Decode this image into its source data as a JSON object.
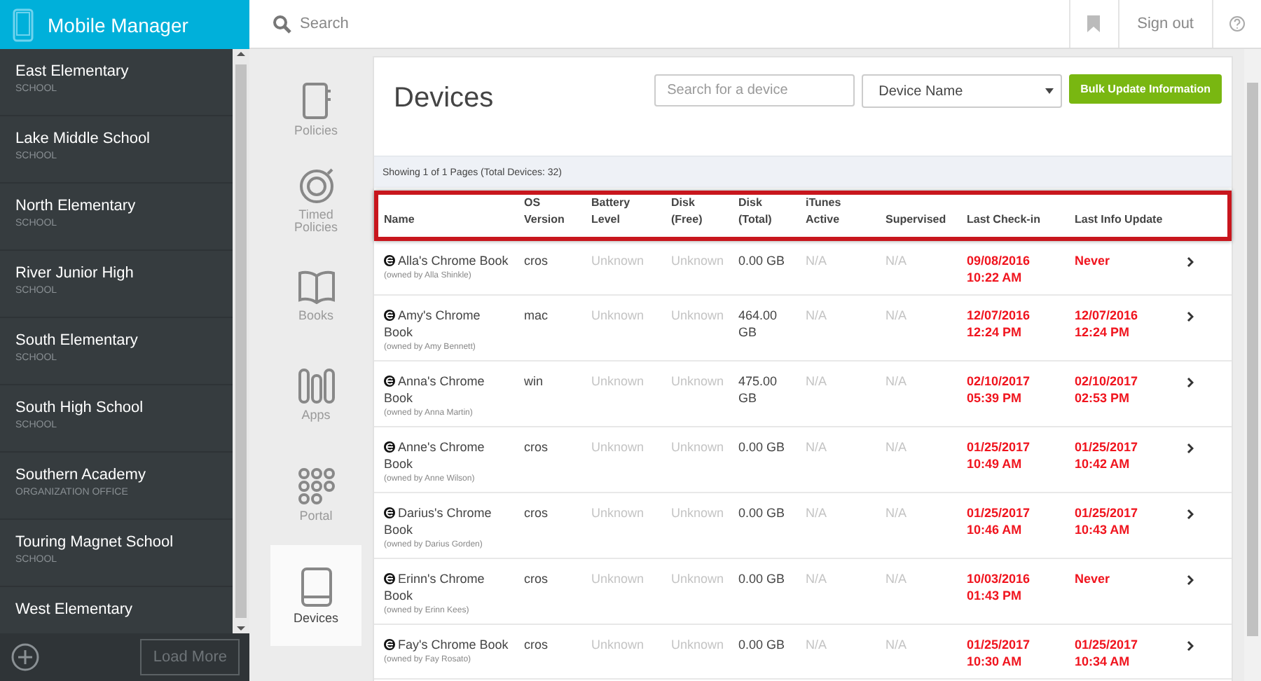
{
  "app": {
    "title": "Mobile Manager"
  },
  "topbar": {
    "search_placeholder": "Search",
    "sign_out": "Sign out"
  },
  "sidebar": {
    "items": [
      {
        "name": "East Elementary",
        "type": "SCHOOL"
      },
      {
        "name": "Lake Middle School",
        "type": "SCHOOL"
      },
      {
        "name": "North Elementary",
        "type": "SCHOOL"
      },
      {
        "name": "River Junior High",
        "type": "SCHOOL"
      },
      {
        "name": "South Elementary",
        "type": "SCHOOL"
      },
      {
        "name": "South High School",
        "type": "SCHOOL"
      },
      {
        "name": "Southern Academy",
        "type": "ORGANIZATION OFFICE"
      },
      {
        "name": "Touring Magnet School",
        "type": "SCHOOL"
      },
      {
        "name": "West Elementary"
      }
    ],
    "load_more": "Load More"
  },
  "nav": [
    {
      "kind": "notebook",
      "label": "Policies",
      "selected": false
    },
    {
      "kind": "timer",
      "label": "Timed Policies",
      "selected": false
    },
    {
      "kind": "book",
      "label": "Books",
      "selected": false
    },
    {
      "kind": "apps",
      "label": "Apps",
      "selected": false
    },
    {
      "kind": "grid",
      "label": "Portal",
      "selected": false
    },
    {
      "kind": "tablet",
      "label": "Devices",
      "selected": true
    }
  ],
  "page": {
    "title": "Devices",
    "search_placeholder": "Search for a device",
    "sort_select": "Device Name",
    "bulk_button": "Bulk Update Information"
  },
  "table": {
    "summary": "Showing 1 of 1 Pages (Total Devices: 32)",
    "header_highlighted": true,
    "columns": [
      "Name",
      "OS Version",
      "Battery Level",
      "Disk (Free)",
      "Disk (Total)",
      "iTunes Active",
      "Supervised",
      "Last Check-in",
      "Last Info Update"
    ],
    "rows": [
      {
        "name": "Alla's Chrome Book",
        "owner": "(owned by Alla Shinkle)",
        "os": "cros",
        "battery": "Unknown",
        "disk_free": "Unknown",
        "disk_total": "0.00 GB",
        "itunes": "N/A",
        "supervised": "N/A",
        "last_checkin": "09/08/2016 10:22 AM",
        "last_info": "Never"
      },
      {
        "name": "Amy's Chrome Book",
        "owner": "(owned by Amy Bennett)",
        "os": "mac",
        "battery": "Unknown",
        "disk_free": "Unknown",
        "disk_total": "464.00 GB",
        "itunes": "N/A",
        "supervised": "N/A",
        "last_checkin": "12/07/2016 12:24 PM",
        "last_info": "12/07/2016 12:24 PM"
      },
      {
        "name": "Anna's Chrome Book",
        "owner": "(owned by Anna Martin)",
        "os": "win",
        "battery": "Unknown",
        "disk_free": "Unknown",
        "disk_total": "475.00 GB",
        "itunes": "N/A",
        "supervised": "N/A",
        "last_checkin": "02/10/2017 05:39 PM",
        "last_info": "02/10/2017 02:53 PM"
      },
      {
        "name": "Anne's Chrome Book",
        "owner": "(owned by Anne Wilson)",
        "os": "cros",
        "battery": "Unknown",
        "disk_free": "Unknown",
        "disk_total": "0.00 GB",
        "itunes": "N/A",
        "supervised": "N/A",
        "last_checkin": "01/25/2017 10:49 AM",
        "last_info": "01/25/2017 10:42 AM"
      },
      {
        "name": "Darius's Chrome Book",
        "owner": "(owned by Darius Gorden)",
        "os": "cros",
        "battery": "Unknown",
        "disk_free": "Unknown",
        "disk_total": "0.00 GB",
        "itunes": "N/A",
        "supervised": "N/A",
        "last_checkin": "01/25/2017 10:46 AM",
        "last_info": "01/25/2017 10:43 AM"
      },
      {
        "name": "Erinn's Chrome Book",
        "owner": "(owned by Erinn Kees)",
        "os": "cros",
        "battery": "Unknown",
        "disk_free": "Unknown",
        "disk_total": "0.00 GB",
        "itunes": "N/A",
        "supervised": "N/A",
        "last_checkin": "10/03/2016 01:43 PM",
        "last_info": "Never"
      },
      {
        "name": "Fay's Chrome Book",
        "owner": "(owned by Fay Rosato)",
        "os": "cros",
        "battery": "Unknown",
        "disk_free": "Unknown",
        "disk_total": "0.00 GB",
        "itunes": "N/A",
        "supervised": "N/A",
        "last_checkin": "01/25/2017 10:30 AM",
        "last_info": "01/25/2017 10:34 AM"
      }
    ]
  }
}
